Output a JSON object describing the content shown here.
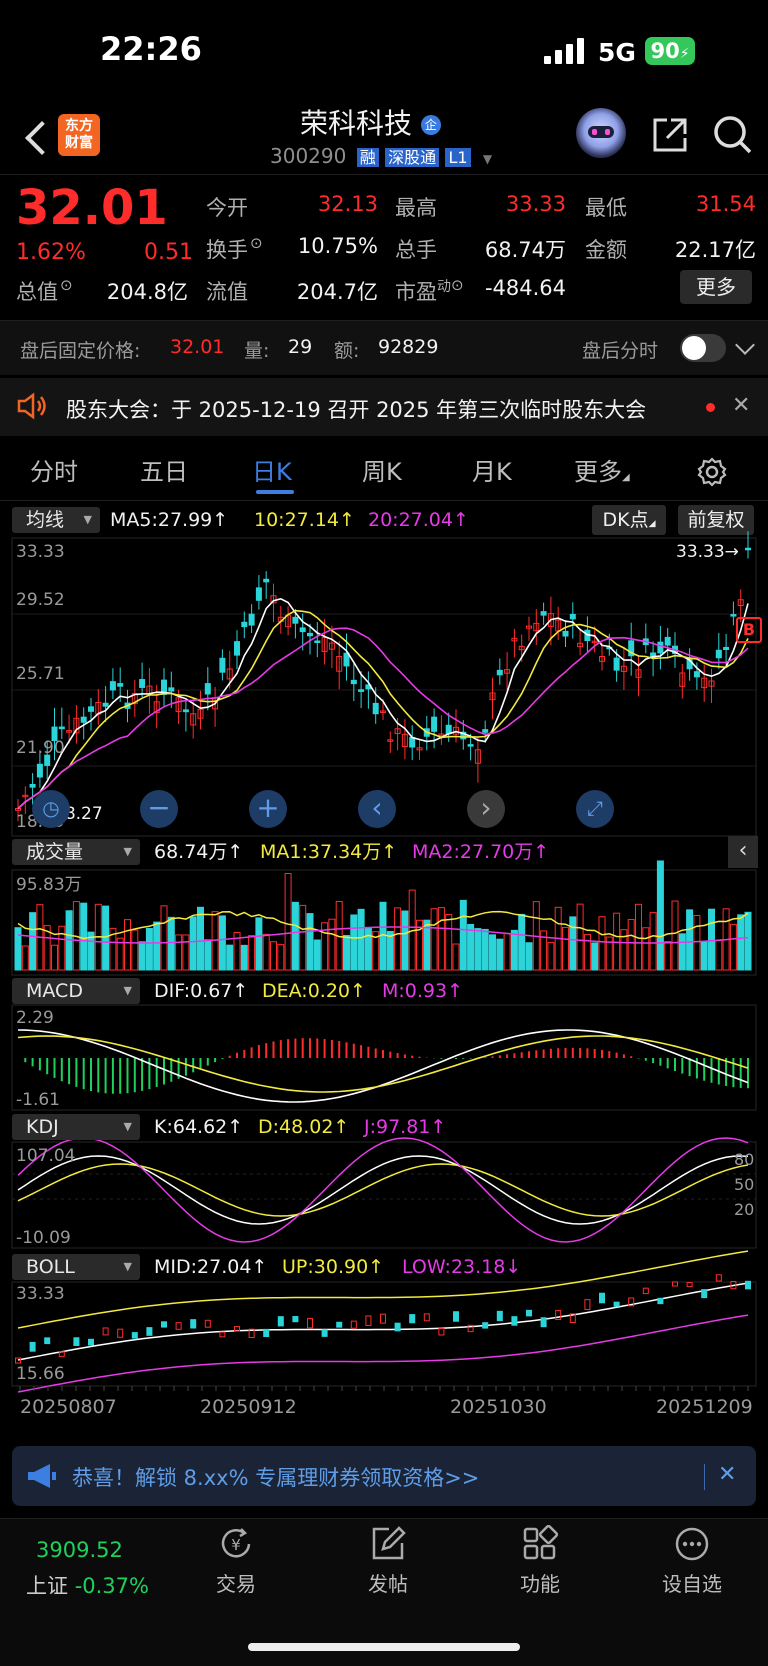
{
  "status_bar": {
    "time": "22:26",
    "network": "5G",
    "battery": "90"
  },
  "header": {
    "app_logo": "东方\n财富",
    "stock_name": "荣科科技",
    "name_badge": "企",
    "stock_code": "300290",
    "tags": [
      "融",
      "深股通",
      "L1"
    ]
  },
  "quote": {
    "price": "32.01",
    "change_pct": "1.62%",
    "change": "0.51",
    "open_label": "今开",
    "open": "32.13",
    "high_label": "最高",
    "high": "33.33",
    "low_label": "最低",
    "low": "31.54",
    "turnover_label": "换手",
    "turnover": "10.75%",
    "volume_label": "总手",
    "volume": "68.74万",
    "amount_label": "金额",
    "amount": "22.17亿",
    "mktcap_label": "总值",
    "mktcap": "204.8亿",
    "float_label": "流值",
    "float_cap": "204.7亿",
    "pe_label": "市盈",
    "pe_sup": "动",
    "pe": "-484.64",
    "more_label": "更多"
  },
  "after_hours": {
    "label": "盘后固定价格:",
    "price": "32.01",
    "vol_label": "量:",
    "vol": "29",
    "amt_label": "额:",
    "amt": "92829",
    "toggle_label": "盘后分时"
  },
  "notice": {
    "text": "股东大会：于 2025-12-19 召开 2025 年第三次临时股东大会"
  },
  "tabs": [
    "分时",
    "五日",
    "日K",
    "周K",
    "月K",
    "更多"
  ],
  "active_tab": "日K",
  "kline": {
    "indicator_select": "均线",
    "ma5": "MA5:27.99↑",
    "ma10": "10:27.14↑",
    "ma20": "20:27.04↑",
    "dk_label": "DK点",
    "adjust_label": "前复权",
    "y_labels": [
      "33.33",
      "29.52",
      "25.71",
      "21.90",
      "18.09"
    ],
    "high_mark": "33.33→",
    "low_mark": "18.27",
    "buy_mark": "B"
  },
  "volume_panel": {
    "select": "成交量",
    "vol": "68.74万↑",
    "ma1": "MA1:37.34万↑",
    "ma2": "MA2:27.70万↑",
    "max_label": "95.83万"
  },
  "macd_panel": {
    "select": "MACD",
    "dif": "DIF:0.67↑",
    "dea": "DEA:0.20↑",
    "m": "M:0.93↑",
    "y_top": "2.29",
    "y_bottom": "-1.61"
  },
  "kdj_panel": {
    "select": "KDJ",
    "k": "K:64.62↑",
    "d": "D:48.02↑",
    "j": "J:97.81↑",
    "y_top": "107.04",
    "y_bottom": "-10.09",
    "levels": [
      "80",
      "50",
      "20"
    ]
  },
  "boll_panel": {
    "select": "BOLL",
    "mid": "MID:27.04↑",
    "up": "UP:30.90↑",
    "low": "LOW:23.18↓",
    "y_top": "33.33",
    "y_bottom": "15.66"
  },
  "dates": [
    "20250807",
    "20250912",
    "20251030",
    "20251209"
  ],
  "banner": {
    "text": "恭喜！解锁 8.xx% 专属理财券领取资格>>"
  },
  "bottom_nav": {
    "index_value": "3909.52",
    "index_name": "上证",
    "index_change": "-0.37%",
    "items": [
      "交易",
      "发帖",
      "功能",
      "设自选"
    ]
  },
  "colors": {
    "up": "#ff2c2c",
    "down": "#2bd4d9",
    "ma5": "#ffffff",
    "ma10": "#f2ea3e",
    "ma20": "#e53be6",
    "accent": "#3d7fe0"
  }
}
